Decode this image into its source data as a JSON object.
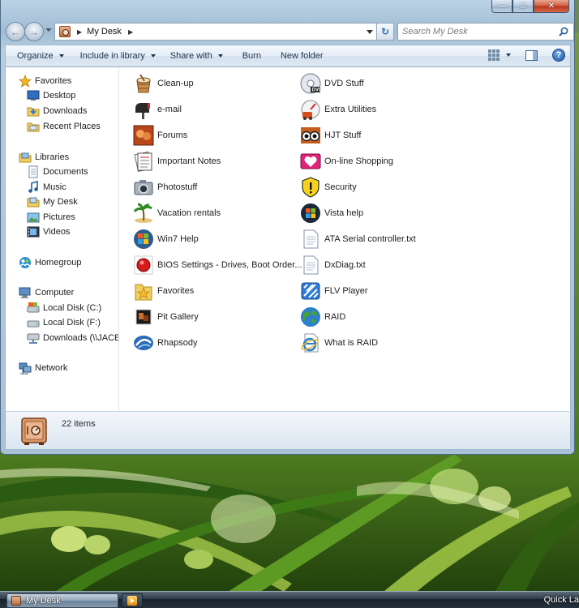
{
  "window": {
    "breadcrumb": "My Desk",
    "search_placeholder": "Search My Desk"
  },
  "toolbar": {
    "organize": "Organize",
    "include_in_library": "Include in library",
    "share_with": "Share with",
    "burn": "Burn",
    "new_folder": "New folder"
  },
  "nav": {
    "favorites": "Favorites",
    "desktop": "Desktop",
    "downloads": "Downloads",
    "recent_places": "Recent Places",
    "libraries": "Libraries",
    "documents": "Documents",
    "music": "Music",
    "my_desk": "My Desk",
    "pictures": "Pictures",
    "videos": "Videos",
    "homegroup": "Homegroup",
    "computer": "Computer",
    "local_disk_c": "Local Disk (C:)",
    "local_disk_f": "Local Disk (F:)",
    "downloads_net": "Downloads (\\\\JACEE",
    "network": "Network"
  },
  "files": {
    "clean_up": "Clean-up",
    "email": "e-mail",
    "forums": "Forums",
    "important_notes": "Important Notes",
    "photostuff": "Photostuff",
    "vacation_rentals": "Vacation rentals",
    "win7_help": "Win7 Help",
    "bios_settings": "BIOS Settings - Drives, Boot Order...",
    "favorites": "Favorites",
    "pit_gallery": "Pit Gallery",
    "rhapsody": "Rhapsody",
    "dvd_stuff": "DVD Stuff",
    "extra_utilities": "Extra Utilities",
    "hjt_stuff": "HJT Stuff",
    "online_shopping": "On-line Shopping",
    "security": "Security",
    "vista_help": "Vista help",
    "ata_serial": "ATA Serial controller.txt",
    "dxdiag": "DxDiag.txt",
    "flv_player": "FLV Player",
    "raid": "RAID",
    "what_is_raid": "What is RAID"
  },
  "details": {
    "item_count": "22 items"
  },
  "taskbar": {
    "active_window": "My Desk",
    "quick_launch": "Quick La"
  }
}
